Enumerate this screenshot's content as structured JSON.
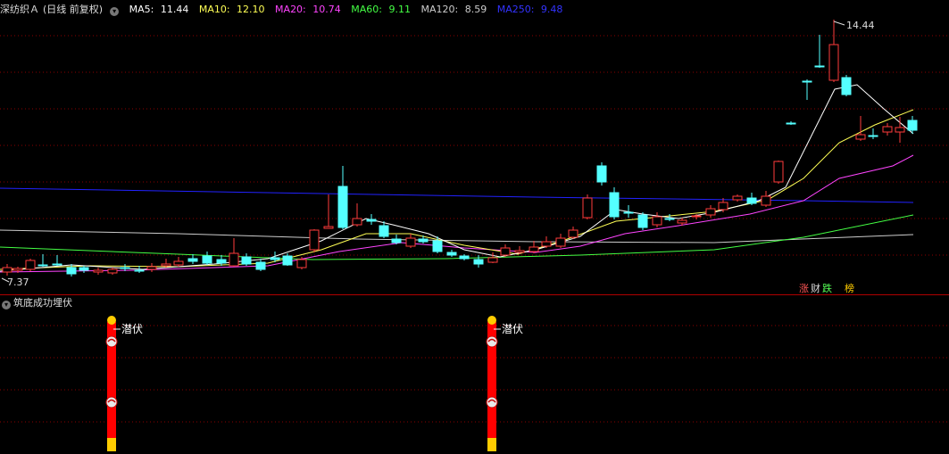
{
  "header": {
    "stock_name": "深纺织Ａ",
    "period": "(日线 前复权)",
    "ma_items": [
      {
        "label": "MA5:",
        "value": "11.44",
        "color": "#ffffff"
      },
      {
        "label": "MA10:",
        "value": "12.10",
        "color": "#ffff55"
      },
      {
        "label": "MA20:",
        "value": "10.74",
        "color": "#ff44ff"
      },
      {
        "label": "MA60:",
        "value": "9.11",
        "color": "#44ff44"
      },
      {
        "label": "MA120:",
        "value": "8.59",
        "color": "#cccccc"
      },
      {
        "label": "MA250:",
        "value": "9.48",
        "color": "#3333ff"
      }
    ]
  },
  "price_labels": {
    "high": "14.44",
    "low": "7.37"
  },
  "badges": [
    {
      "text": "涨",
      "color": "#ff5555"
    },
    {
      "text": "财",
      "color": "#dddddd"
    },
    {
      "text": "跌",
      "color": "#55ff55"
    },
    {
      "text": "榜",
      "color": "#ffcc00"
    }
  ],
  "indicator": {
    "title": "筑底成功埋伏",
    "signal_label_1": "潜伏",
    "signal_label_2": "潜伏"
  },
  "colors": {
    "up": "#ff3b3b",
    "down": "#54ffff",
    "grid": "#8b0000",
    "signal_bar": "#ff0000",
    "signal_top": "#ffcc00"
  }
}
